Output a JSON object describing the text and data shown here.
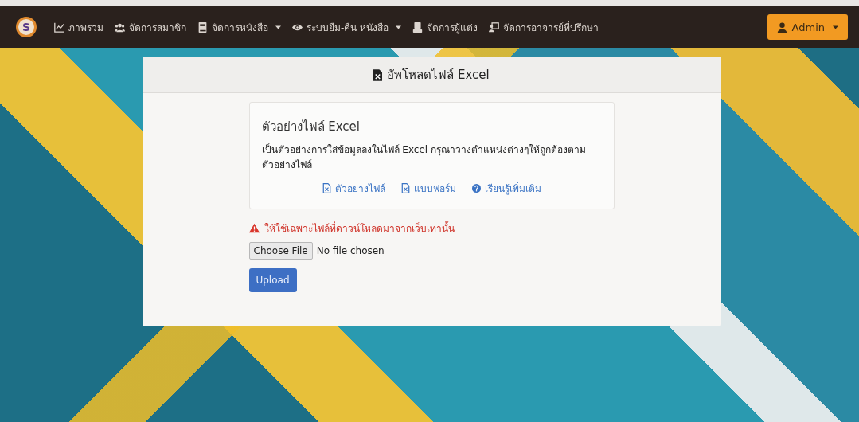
{
  "navbar": {
    "logo": "S",
    "items": [
      {
        "label": "ภาพรวม",
        "dropdown": false
      },
      {
        "label": "จัดการสมาชิก",
        "dropdown": false
      },
      {
        "label": "จัดการหนังสือ",
        "dropdown": true
      },
      {
        "label": "ระบบยืม-คืน หนังสือ",
        "dropdown": true
      },
      {
        "label": "จัดการผู้แต่ง",
        "dropdown": false
      },
      {
        "label": "จัดการอาจารย์ที่ปรึกษา",
        "dropdown": false
      }
    ],
    "user_menu": {
      "label": "Admin",
      "dropdown": true
    }
  },
  "card": {
    "title": "อัพโหลดไฟล์ Excel",
    "sample_box": {
      "heading": "ตัวอย่างไฟล์ Excel",
      "description": "เป็นตัวอย่างการใส่ข้อมูลลงในไฟล์ Excel กรุณาวางตำแหน่งต่างๆให้ถูกต้องตาม ตัวอย่างไฟล์",
      "links": [
        {
          "label": "ตัวอย่างไฟล์",
          "kind": "file"
        },
        {
          "label": "แบบฟอร์ม",
          "kind": "file"
        },
        {
          "label": "เรียนรู้เพิ่มเติม",
          "kind": "help"
        }
      ]
    },
    "warning": "ให้ใช้เฉพาะไฟล์ที่ดาวน์โหลดมาจากเว็บเท่านั้น",
    "file_input": {
      "button": "Choose File",
      "status": "No file chosen"
    },
    "submit": "Upload"
  }
}
